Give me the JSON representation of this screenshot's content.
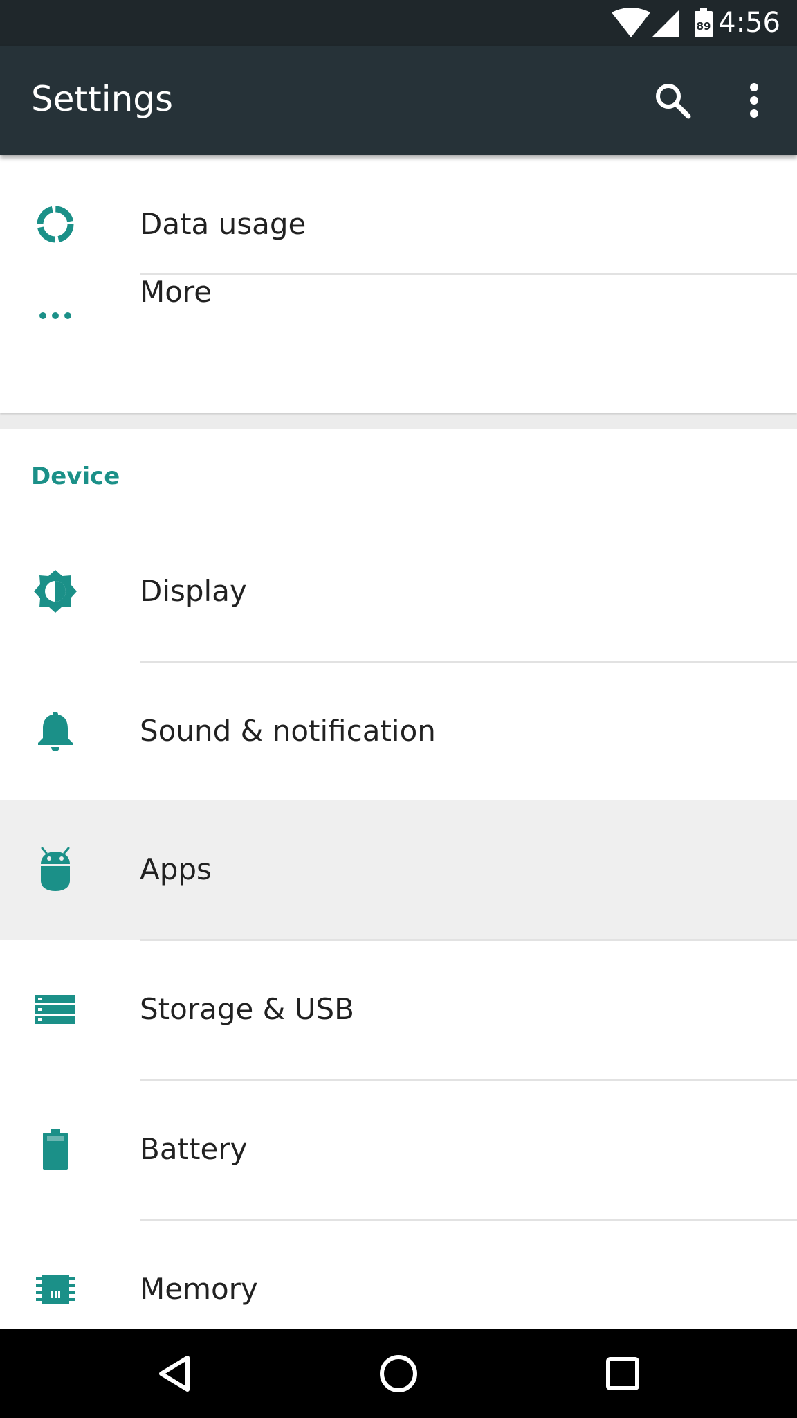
{
  "status_bar": {
    "time": "4:56",
    "battery_level": "89",
    "icons": [
      "wifi-icon",
      "cell-signal-icon",
      "battery-icon"
    ]
  },
  "app_bar": {
    "title": "Settings",
    "actions": [
      "search-icon",
      "more-vert-icon"
    ]
  },
  "colors": {
    "accent": "#1b9088",
    "app_bar": "#263238",
    "status_bar": "#1f272b",
    "highlight_row": "#efefef"
  },
  "wireless_section": {
    "items": [
      {
        "label": "Data usage",
        "icon": "data-usage-icon"
      },
      {
        "label": "More",
        "icon": "more-horiz-icon"
      }
    ]
  },
  "device_section": {
    "header": "Device",
    "items": [
      {
        "label": "Display",
        "icon": "brightness-icon"
      },
      {
        "label": "Sound & notification",
        "icon": "bell-icon"
      },
      {
        "label": "Apps",
        "icon": "android-icon",
        "highlighted": true
      },
      {
        "label": "Storage & USB",
        "icon": "storage-icon"
      },
      {
        "label": "Battery",
        "icon": "battery-full-icon"
      },
      {
        "label": "Memory",
        "icon": "memory-chip-icon"
      }
    ]
  },
  "nav_bar": {
    "buttons": [
      "back-icon",
      "home-icon",
      "recents-icon"
    ]
  }
}
